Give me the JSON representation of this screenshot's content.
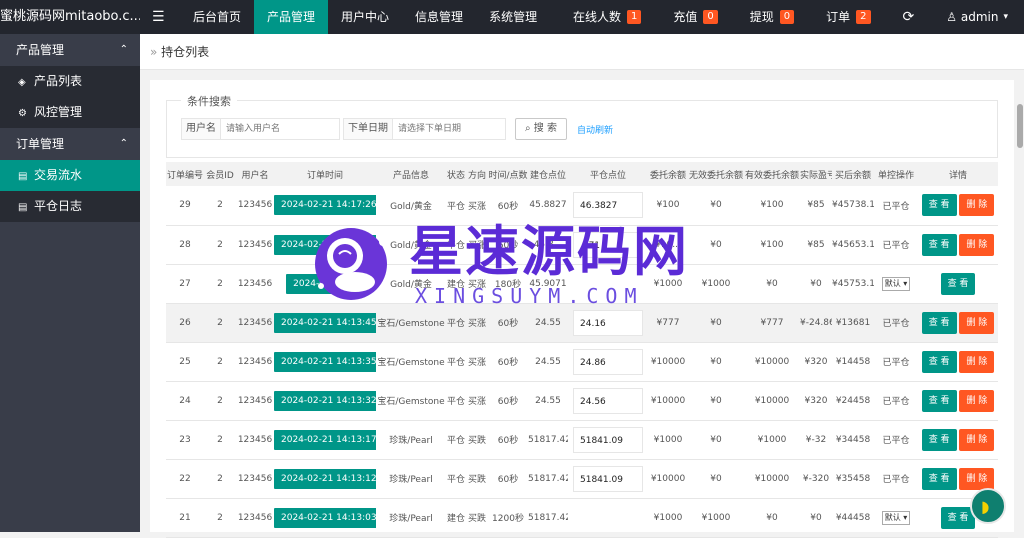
{
  "brand": "蜜桃源码网mitaobo.c...",
  "topnav": {
    "menu_icon": "menu-icon",
    "items": [
      "后台首页",
      "产品管理",
      "用户中心",
      "信息管理",
      "系统管理"
    ],
    "active_index": 1
  },
  "rightnav": {
    "online": {
      "label": "在线人数",
      "count": "1"
    },
    "recharge": {
      "label": "充值",
      "count": "0"
    },
    "withdraw": {
      "label": "提现",
      "count": "0"
    },
    "orders": {
      "label": "订单",
      "count": "2"
    },
    "user": "admin"
  },
  "sidebar": {
    "groups": [
      {
        "label": "产品管理",
        "items": [
          {
            "label": "产品列表",
            "icon": "layers-icon"
          },
          {
            "label": "风控管理",
            "icon": "gear-icon"
          }
        ]
      },
      {
        "label": "订单管理",
        "items": [
          {
            "label": "交易流水",
            "icon": "doc-icon",
            "active": true
          },
          {
            "label": "平仓日志",
            "icon": "doc-icon"
          }
        ]
      }
    ]
  },
  "breadcrumb": "持仓列表",
  "search": {
    "legend": "条件搜索",
    "username_label": "用户名",
    "username_placeholder": "请输入用户名",
    "date_label": "下单日期",
    "date_placeholder": "请选择下单日期",
    "search_button": "搜 索",
    "auto_refresh": "自动刷新"
  },
  "table": {
    "headers": [
      "订单编号",
      "会员ID",
      "用户名",
      "订单时间",
      "产品信息",
      "状态",
      "方向",
      "时间/点数",
      "建仓点位",
      "平仓点位",
      "委托余额",
      "无效委托余额",
      "有效委托余额",
      "实际盈亏",
      "买后余额",
      "单控操作",
      "详情"
    ],
    "view_label": "查 看",
    "delete_label": "删 除",
    "select_default": "默认",
    "rows": [
      {
        "id": "29",
        "uid": "2",
        "user": "123456",
        "time": "2024-02-21 14:17:26",
        "product": "Gold/黄金",
        "status": "平仓",
        "dir": "买涨",
        "dir_color": "red",
        "dur": "60秒",
        "open": "45.8827",
        "close": "46.3827",
        "entrust": "¥100",
        "invalid": "¥0",
        "valid": "¥100",
        "pnl": "¥85",
        "pnl_color": "red",
        "after": "¥45738.1",
        "ctrl": "已平仓",
        "del": true
      },
      {
        "id": "28",
        "uid": "2",
        "user": "123456",
        "time": "2024-02-21 14:15:...",
        "product": "Gold/黄金",
        "status": "平仓",
        "dir": "买涨",
        "dir_color": "red",
        "dur": "60秒",
        "open": "45.8...",
        "close": "...71",
        "entrust": "¥10...",
        "invalid": "¥0",
        "valid": "¥100",
        "pnl": "¥85",
        "pnl_color": "red",
        "after": "¥45653.1",
        "ctrl": "已平仓",
        "del": true
      },
      {
        "id": "27",
        "uid": "2",
        "user": "123456",
        "time": "2024-02-21 ...",
        "product": "Gold/黄金",
        "status": "建仓",
        "dir": "买涨",
        "dir_color": "red",
        "dur": "180秒",
        "open": "45.9071",
        "close": "",
        "entrust": "¥1000",
        "invalid": "¥1000",
        "valid": "¥0",
        "pnl": "¥0",
        "pnl_color": "green",
        "after": "¥45753.1",
        "ctrl": "select",
        "del": false
      },
      {
        "id": "26",
        "uid": "2",
        "user": "123456",
        "time": "2024-02-21 14:13:45",
        "product": "宝石/Gemstone",
        "status": "平仓",
        "dir": "买涨",
        "dir_color": "red",
        "dur": "60秒",
        "open": "24.55",
        "close": "24.16",
        "entrust": "¥777",
        "invalid": "¥0",
        "valid": "¥777",
        "pnl": "¥-24.86",
        "pnl_color": "green",
        "after": "¥13681",
        "ctrl": "已平仓",
        "del": true,
        "hl": true
      },
      {
        "id": "25",
        "uid": "2",
        "user": "123456",
        "time": "2024-02-21 14:13:35",
        "product": "宝石/Gemstone",
        "status": "平仓",
        "dir": "买涨",
        "dir_color": "red",
        "dur": "60秒",
        "open": "24.55",
        "close": "24.86",
        "entrust": "¥10000",
        "invalid": "¥0",
        "valid": "¥10000",
        "pnl": "¥320",
        "pnl_color": "red",
        "after": "¥14458",
        "ctrl": "已平仓",
        "del": true
      },
      {
        "id": "24",
        "uid": "2",
        "user": "123456",
        "time": "2024-02-21 14:13:32",
        "product": "宝石/Gemstone",
        "status": "平仓",
        "dir": "买涨",
        "dir_color": "red",
        "dur": "60秒",
        "open": "24.55",
        "close": "24.56",
        "entrust": "¥10000",
        "invalid": "¥0",
        "valid": "¥10000",
        "pnl": "¥320",
        "pnl_color": "red",
        "after": "¥24458",
        "ctrl": "已平仓",
        "del": true
      },
      {
        "id": "23",
        "uid": "2",
        "user": "123456",
        "time": "2024-02-21 14:13:17",
        "product": "珍珠/Pearl",
        "status": "平仓",
        "dir": "买跌",
        "dir_color": "green",
        "dur": "60秒",
        "open": "51817.42",
        "close": "51841.09",
        "entrust": "¥1000",
        "invalid": "¥0",
        "valid": "¥1000",
        "pnl": "¥-32",
        "pnl_color": "green",
        "after": "¥34458",
        "ctrl": "已平仓",
        "del": true
      },
      {
        "id": "22",
        "uid": "2",
        "user": "123456",
        "time": "2024-02-21 14:13:12",
        "product": "珍珠/Pearl",
        "status": "平仓",
        "dir": "买跌",
        "dir_color": "green",
        "dur": "60秒",
        "open": "51817.42",
        "close": "51841.09",
        "entrust": "¥10000",
        "invalid": "¥0",
        "valid": "¥10000",
        "pnl": "¥-320",
        "pnl_color": "green",
        "after": "¥35458",
        "ctrl": "已平仓",
        "del": true
      },
      {
        "id": "21",
        "uid": "2",
        "user": "123456",
        "time": "2024-02-21 14:13:03",
        "product": "珍珠/Pearl",
        "status": "建仓",
        "dir": "买跌",
        "dir_color": "green",
        "dur": "1200秒",
        "open": "51817.42",
        "close": "",
        "entrust": "¥1000",
        "invalid": "¥1000",
        "valid": "¥0",
        "pnl": "¥0",
        "pnl_color": "green",
        "after": "¥44458",
        "ctrl": "select",
        "del": false
      }
    ]
  },
  "watermark": {
    "title": "星速源码网",
    "subtitle": "XINGSUYM.COM"
  },
  "colors": {
    "topbar": "#23262e",
    "sidebar": "#393d49",
    "accent": "#009688",
    "danger": "#ff5722",
    "badge": "#ff5722"
  }
}
